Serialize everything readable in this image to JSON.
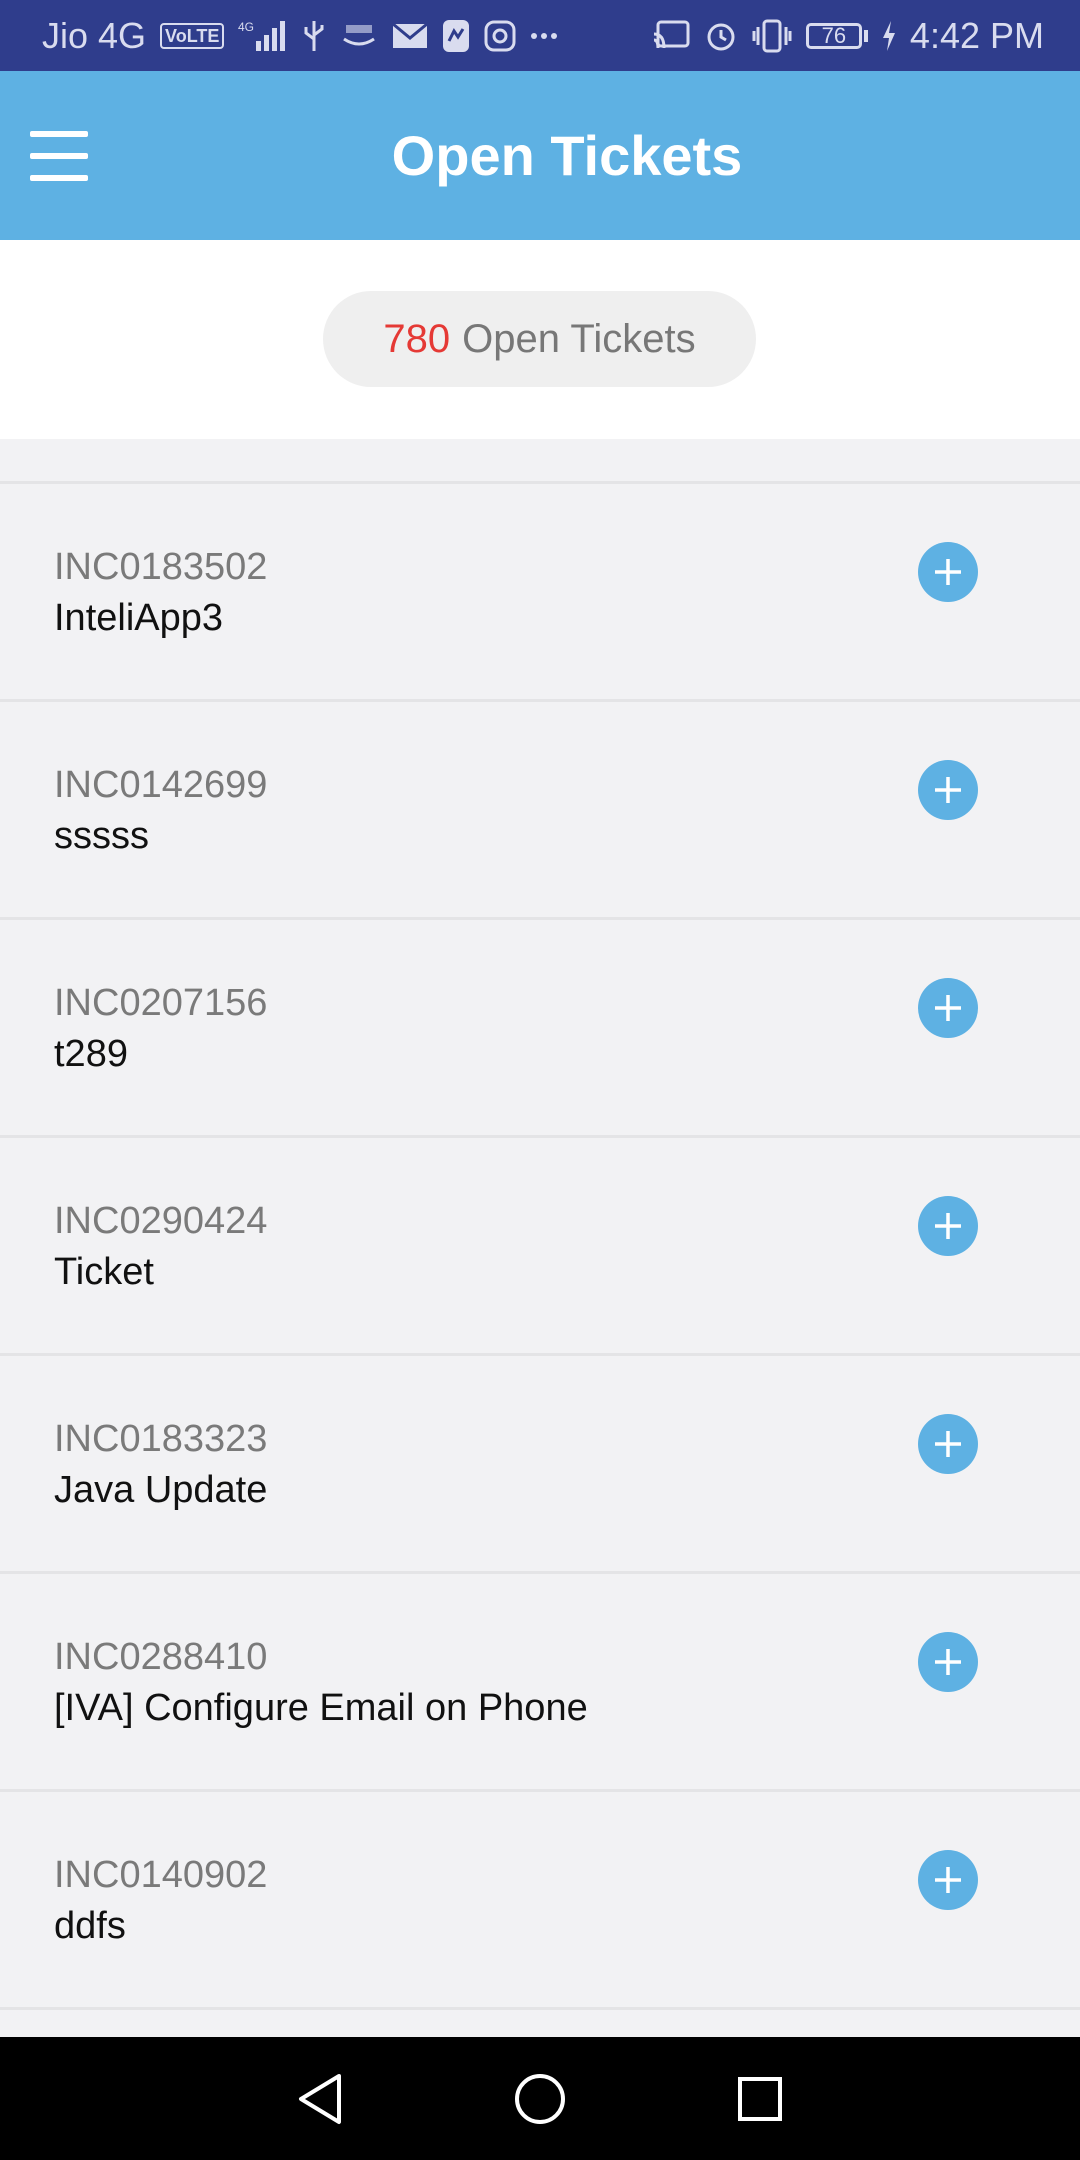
{
  "status_bar": {
    "carrier": "Jio 4G",
    "volte_label": "VoLTE",
    "net_label": "4G",
    "battery_level": "76",
    "time": "4:42 PM"
  },
  "app_bar": {
    "title": "Open Tickets"
  },
  "summary": {
    "count": "780",
    "label": "Open Tickets"
  },
  "tickets": [
    {
      "id": "INC0183502",
      "description": "InteliApp3"
    },
    {
      "id": "INC0142699",
      "description": "sssss"
    },
    {
      "id": "INC0207156",
      "description": "t289"
    },
    {
      "id": "INC0290424",
      "description": "Ticket"
    },
    {
      "id": "INC0183323",
      "description": "Java Update"
    },
    {
      "id": "INC0288410",
      "description": "[IVA] Configure Email on Phone"
    },
    {
      "id": "INC0140902",
      "description": "ddfs"
    }
  ],
  "colors": {
    "status_bar": "#2f3d8c",
    "app_bar": "#5eb1e3",
    "count_highlight": "#e53935",
    "add_button": "#5eb1e3"
  },
  "icons": {
    "menu": "hamburger-menu-icon",
    "add": "plus-circle-icon",
    "nav_back": "triangle-back-icon",
    "nav_home": "circle-home-icon",
    "nav_recents": "square-recents-icon"
  }
}
